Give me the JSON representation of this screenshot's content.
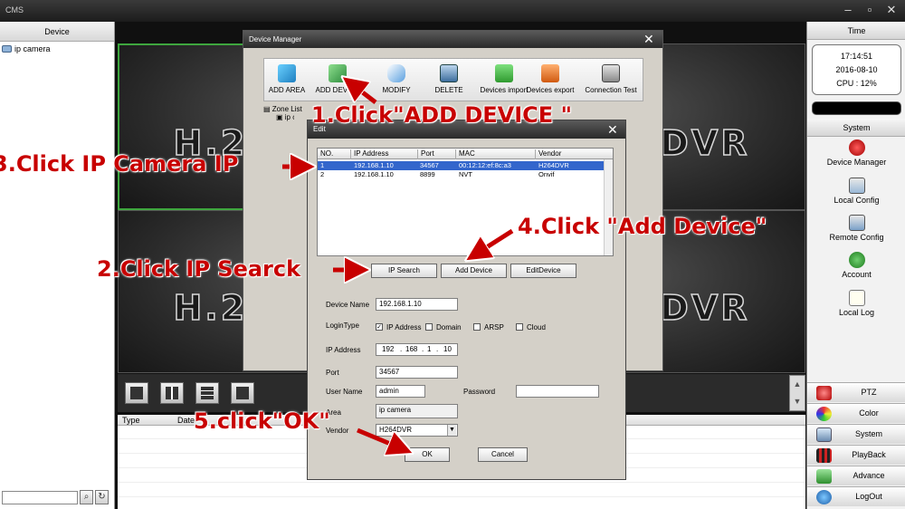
{
  "window": {
    "title": "CMS"
  },
  "left_panel": {
    "header": "Device",
    "tree_item": "ip camera"
  },
  "video": {
    "overlay_text": "H.264 DVR"
  },
  "event_table": {
    "col_type": "Type",
    "col_date": "Date"
  },
  "right_panel": {
    "time_header": "Time",
    "clock": {
      "time": "17:14:51",
      "date": "2016-08-10",
      "cpu": "CPU : 12%"
    },
    "system_header": "System",
    "system_items": [
      "Device Manager",
      "Local Config",
      "Remote Config",
      "Account",
      "Local Log"
    ],
    "bottom_buttons": [
      "PTZ",
      "Color",
      "System",
      "PlayBack",
      "Advance",
      "LogOut"
    ]
  },
  "device_manager": {
    "title": "Device Manager",
    "tools": [
      "ADD AREA",
      "ADD DEVICE",
      "MODIFY",
      "DELETE",
      "Devices import",
      "Devices export",
      "Connection Test"
    ],
    "zone_list": "Zone List",
    "zone_child": "ip camera"
  },
  "edit_dialog": {
    "title": "Edit",
    "columns": [
      "NO.",
      "IP Address",
      "Port",
      "MAC",
      "Vendor"
    ],
    "rows": [
      {
        "no": "1",
        "ip": "192.168.1.10",
        "port": "34567",
        "mac": "00:12:12:ef:8c:a3",
        "vendor": "H264DVR"
      },
      {
        "no": "2",
        "ip": "192.168.1.10",
        "port": "8899",
        "mac": "NVT",
        "vendor": "Onvif"
      }
    ],
    "buttons": {
      "ip_search": "IP Search",
      "add_device": "Add Device",
      "edit_device": "EditDevice",
      "ok": "OK",
      "cancel": "Cancel"
    },
    "labels": {
      "device_name": "Device Name",
      "login_type": "LoginType",
      "ip_address": "IP Address",
      "port": "Port",
      "user_name": "User Name",
      "password": "Password",
      "area": "Area",
      "vendor": "Vendor"
    },
    "login_types": [
      "IP Address",
      "Domain",
      "ARSP",
      "Cloud"
    ],
    "values": {
      "device_name": "192.168.1.10",
      "ip": [
        "192",
        "168",
        "1",
        "10"
      ],
      "port": "34567",
      "user_name": "admin",
      "password": "",
      "area": "ip camera",
      "vendor": "H264DVR"
    }
  },
  "annotations": {
    "step1": "1.Click\"ADD DEVICE \"",
    "step2": "2.Click IP Searck",
    "step3": "3.Click IP Camera IP",
    "step4": "4.Click \"Add Device\"",
    "step5": "5.click\"OK\""
  },
  "colors": {
    "annotation": "#c80000",
    "selection": "#3366cc",
    "selected_tile_border": "#3ea63e"
  }
}
